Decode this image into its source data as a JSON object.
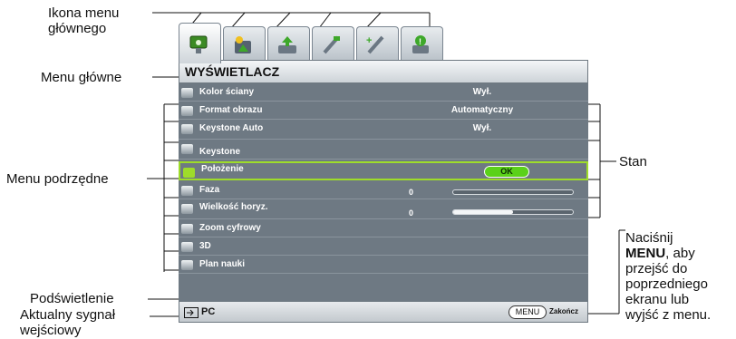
{
  "callouts": {
    "main_menu_icon": [
      "Ikona menu",
      "głównego"
    ],
    "main_menu": "Menu główne",
    "submenu": "Menu podrzędne",
    "highlight": "Podświetlenie",
    "current_input": [
      "Aktualny sygnał",
      "wejściowy"
    ],
    "status": "Stan",
    "menu_hint_line1": "Naciśnij",
    "menu_hint_bold": "MENU",
    "menu_hint_rest": [
      ", aby",
      "przejść do",
      "poprzedniego",
      "ekranu lub",
      "wyjść z menu."
    ]
  },
  "osd": {
    "tabs": [
      {
        "icon": "display-icon",
        "active": true
      },
      {
        "icon": "picture-icon",
        "active": false
      },
      {
        "icon": "source-icon",
        "active": false
      },
      {
        "icon": "system-setup-basic-icon",
        "active": false
      },
      {
        "icon": "system-setup-advanced-icon",
        "active": false
      },
      {
        "icon": "information-icon",
        "active": false
      }
    ],
    "title": "WYŚWIETLACZ",
    "rows": [
      {
        "label": "Kolor ściany",
        "value": "Wył.",
        "icon": "wall-color-icon"
      },
      {
        "label": "Format obrazu",
        "value": "Automatyczny",
        "icon": "aspect-ratio-icon"
      },
      {
        "label": "Keystone Auto",
        "value": "Wył.",
        "icon": "auto-keystone-icon"
      },
      {
        "label": "Keystone",
        "value": "",
        "icon": "keystone-icon"
      },
      {
        "label": "Położenie",
        "button": "OK",
        "icon": "position-icon",
        "selected": true
      },
      {
        "label": "Faza",
        "number": "0",
        "level": 0.0,
        "icon": "phase-icon"
      },
      {
        "label": "Wielkość horyz.",
        "number": "0",
        "level": 0.5,
        "icon": "h-size-icon"
      },
      {
        "label": "Zoom cyfrowy",
        "icon": "digital-zoom-icon"
      },
      {
        "label": "3D",
        "icon": "3d-icon"
      },
      {
        "label": "Plan nauki",
        "icon": "teaching-template-icon"
      }
    ],
    "status": {
      "source": "PC",
      "menu_key": "MENU",
      "exit": "Zakończ"
    },
    "colors": {
      "highlight": "#9edc2a",
      "ok_button": "#5bd11a",
      "body": "#6e7983"
    }
  }
}
